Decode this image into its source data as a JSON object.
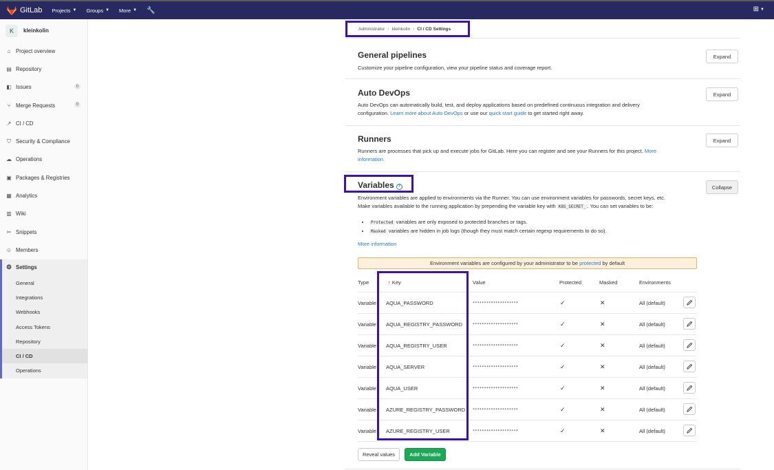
{
  "topbar": {
    "brand": "GitLab",
    "nav": [
      "Projects",
      "Groups",
      "More"
    ]
  },
  "sidebar": {
    "project_initial": "K",
    "project_name": "kleinkolin",
    "items": [
      {
        "label": "Project overview",
        "icon": "home-icon"
      },
      {
        "label": "Repository",
        "icon": "book-icon"
      },
      {
        "label": "Issues",
        "icon": "issues-icon",
        "count": "0"
      },
      {
        "label": "Merge Requests",
        "icon": "merge-request-icon",
        "count": "0"
      },
      {
        "label": "CI / CD",
        "icon": "rocket-icon"
      },
      {
        "label": "Security & Compliance",
        "icon": "shield-icon"
      },
      {
        "label": "Operations",
        "icon": "cloud-icon"
      },
      {
        "label": "Packages & Registries",
        "icon": "package-icon"
      },
      {
        "label": "Analytics",
        "icon": "chart-icon"
      },
      {
        "label": "Wiki",
        "icon": "wiki-icon"
      },
      {
        "label": "Snippets",
        "icon": "scissors-icon"
      },
      {
        "label": "Members",
        "icon": "users-icon"
      }
    ],
    "settings": {
      "label": "Settings",
      "sub_items": [
        "General",
        "Integrations",
        "Webhooks",
        "Access Tokens",
        "Repository",
        "CI / CD",
        "Operations"
      ]
    }
  },
  "breadcrumb": [
    "Administrator",
    "kleinkolin",
    "CI / CD Settings"
  ],
  "sections": {
    "general": {
      "title": "General pipelines",
      "desc": "Customize your pipeline configuration, view your pipeline status and coverage report.",
      "button": "Expand"
    },
    "autodevops": {
      "title": "Auto DevOps",
      "desc1": "Auto DevOps can automatically build, test, and deploy applications based on predefined continuous integration and delivery",
      "desc2": "configuration.",
      "link1": "Learn more about Auto DevOps",
      "desc3": "or use our",
      "link2": "quick start guide",
      "desc4": "to get started right away.",
      "button": "Expand"
    },
    "runners": {
      "title": "Runners",
      "desc": "Runners are processes that pick up and execute jobs for GitLab. Here you can register and see your Runners for this project.",
      "link": "More information",
      "button": "Expand"
    },
    "variables": {
      "title": "Variables",
      "desc1": "Environment variables are applied to environments via the Runner. You can use environment variables for passwords, secret keys, etc.",
      "desc2a": "Make variables available to the running application by prepending the variable key with",
      "desc2code": "K8S_SECRET_",
      "desc2b": ". You can set variables to be:",
      "bullet1_code": "Protected",
      "bullet1": "variables are only exposed to protected branches or tags.",
      "bullet2_code": "Masked",
      "bullet2": "variables are hidden in job logs (though they must match certain regexp requirements to do so).",
      "more": "More information",
      "button": "Collapse",
      "alert_a": "Environment variables are configured by your administrator to be",
      "alert_link": "protected",
      "alert_b": "by default"
    }
  },
  "table": {
    "headers": {
      "type": "Type",
      "key": "Key",
      "value": "Value",
      "protected": "Protected",
      "masked": "Masked",
      "env": "Environments"
    },
    "rows": [
      {
        "type": "Variable",
        "key": "AQUA_PASSWORD",
        "value": "********************",
        "env": "All (default)"
      },
      {
        "type": "Variable",
        "key": "AQUA_REGISTRY_PASSWORD",
        "value": "********************",
        "env": "All (default)"
      },
      {
        "type": "Variable",
        "key": "AQUA_REGISTRY_USER",
        "value": "********************",
        "env": "All (default)"
      },
      {
        "type": "Variable",
        "key": "AQUA_SERVER",
        "value": "********************",
        "env": "All (default)"
      },
      {
        "type": "Variable",
        "key": "AQUA_USER",
        "value": "********************",
        "env": "All (default)"
      },
      {
        "type": "Variable",
        "key": "AZURE_REGISTRY_PASSWORD",
        "value": "********************",
        "env": "All (default)"
      },
      {
        "type": "Variable",
        "key": "AZURE_REGISTRY_USER",
        "value": "********************",
        "env": "All (default)"
      }
    ]
  },
  "actions": {
    "reveal": "Reveal values",
    "add": "Add Variable"
  }
}
